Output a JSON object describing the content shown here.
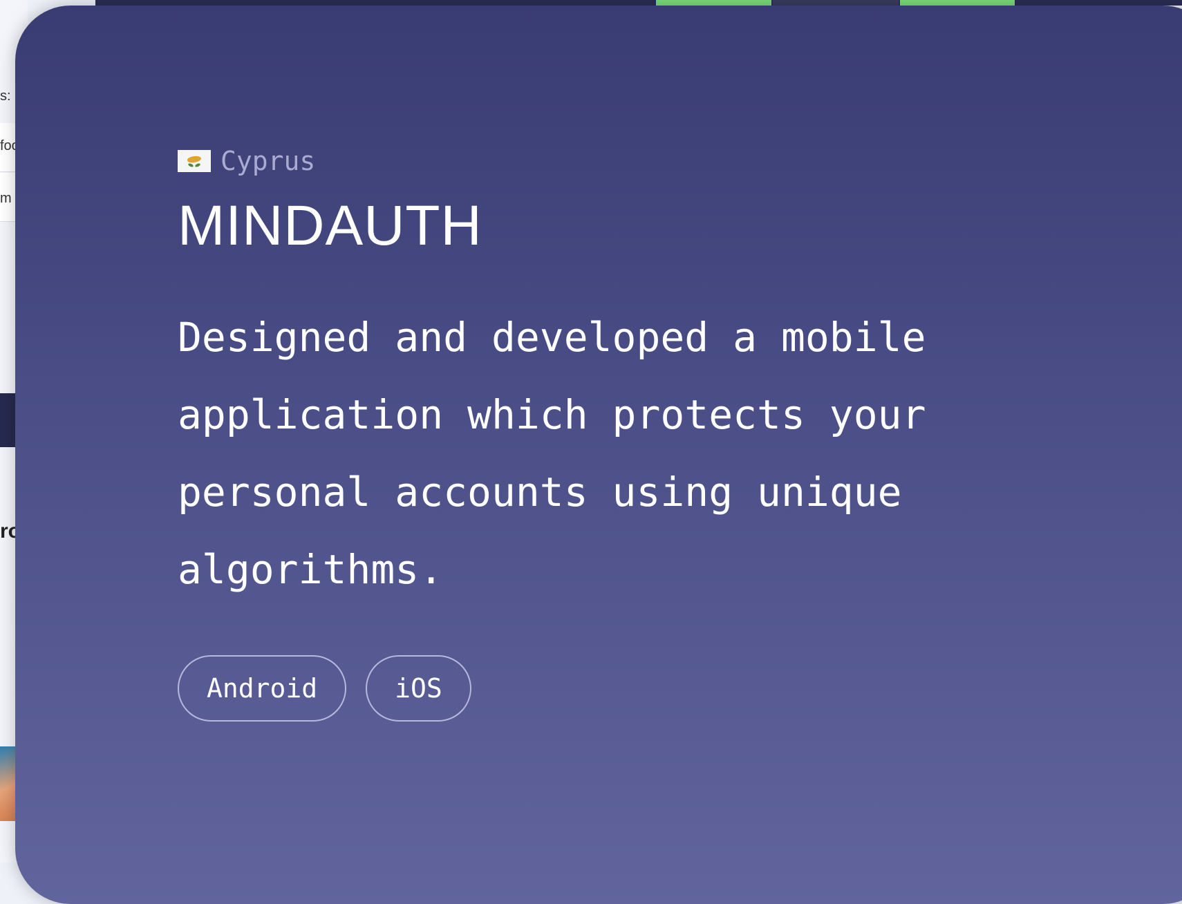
{
  "background_page": {
    "fragments": [
      {
        "text": "s:"
      },
      {
        "text": "foo"
      },
      {
        "text": "m"
      },
      {
        "text": "ro"
      }
    ]
  },
  "project": {
    "country": "Cyprus",
    "flag_icon": "cyprus-flag-icon",
    "title": "MINDAUTH",
    "description": "Designed and developed a mobile application which protects your personal accounts using unique algorithms.",
    "tags": [
      "Android",
      "iOS"
    ]
  },
  "colors": {
    "card_top": "#393c72",
    "card_bottom": "#61649d",
    "country_text": "#a9abd0",
    "text": "#ffffff",
    "tag_border": "#b7b9dc",
    "accent_green": "#7bdc7a"
  }
}
